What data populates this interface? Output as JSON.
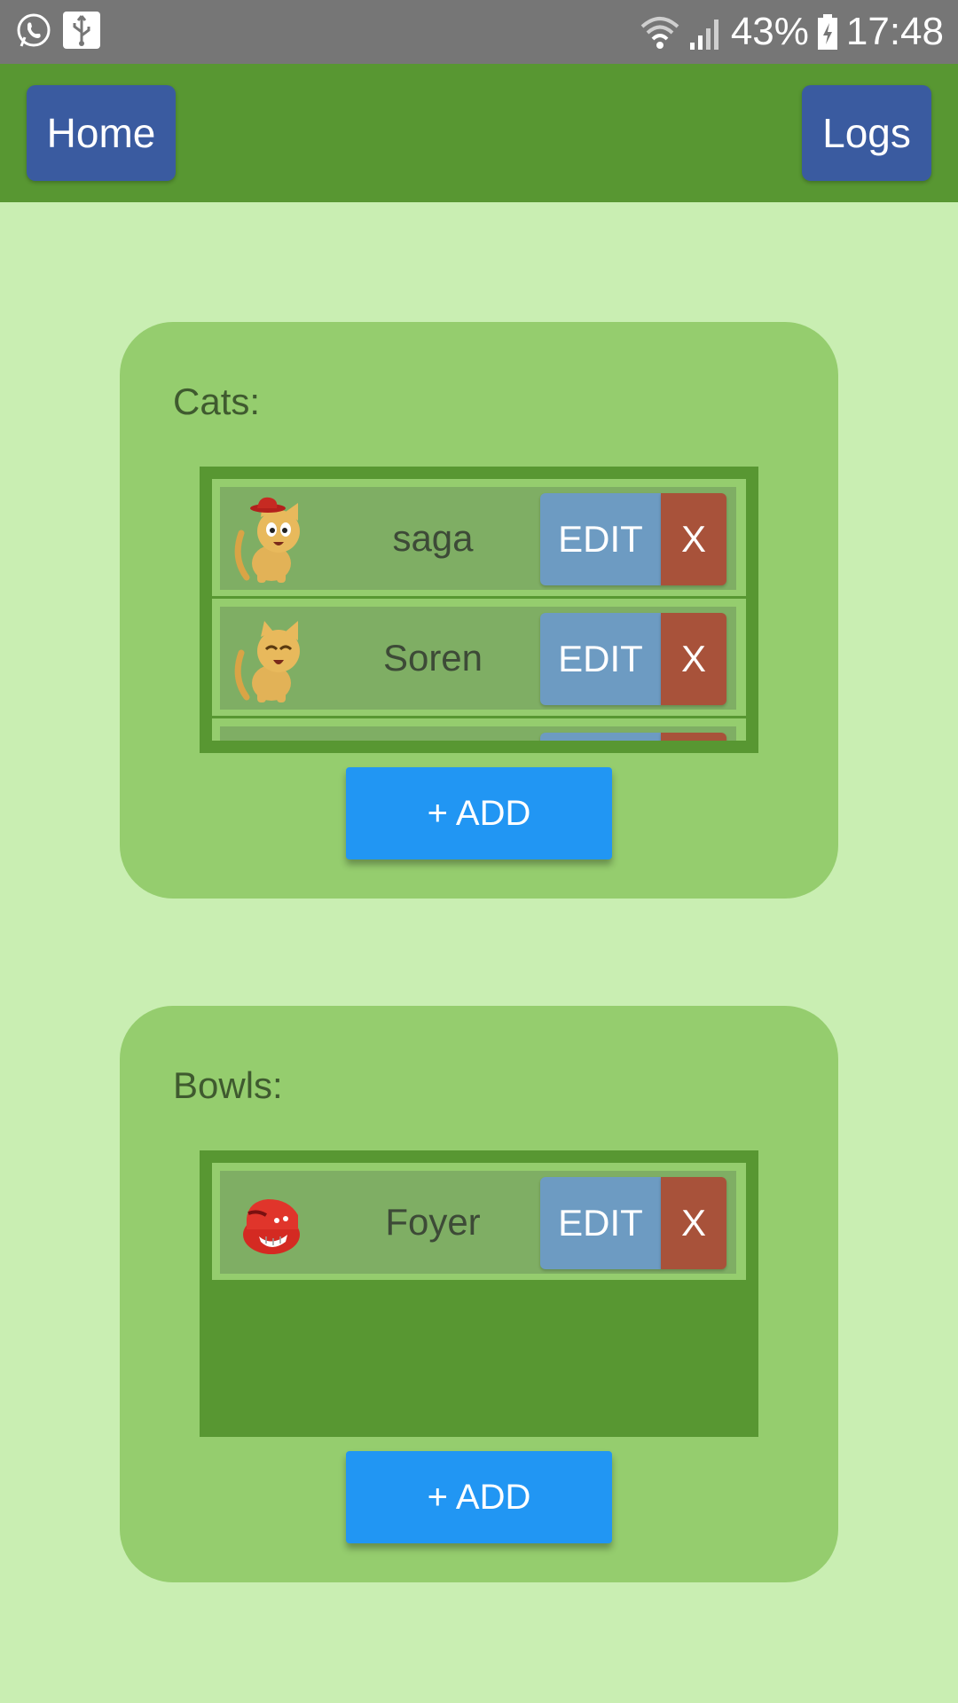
{
  "status_bar": {
    "battery": "43%",
    "time": "17:48",
    "icons": [
      "whatsapp-icon",
      "usb-icon",
      "wifi-icon",
      "signal-icon",
      "battery-charging-icon"
    ]
  },
  "header": {
    "home_label": "Home",
    "logs_label": "Logs"
  },
  "cats": {
    "title": "Cats:",
    "items": [
      {
        "name": "saga",
        "edit_label": "EDIT",
        "delete_label": "X",
        "avatar": "cat-with-hat-icon"
      },
      {
        "name": "Soren",
        "edit_label": "EDIT",
        "delete_label": "X",
        "avatar": "happy-cat-icon"
      }
    ],
    "add_label": "+ ADD"
  },
  "bowls": {
    "title": "Bowls:",
    "items": [
      {
        "name": "Foyer",
        "edit_label": "EDIT",
        "delete_label": "X",
        "avatar": "red-bowl-icon"
      }
    ],
    "add_label": "+ ADD"
  },
  "colors": {
    "page_bg": "#c9eeb2",
    "topbar": "#589732",
    "nav_button": "#3a5ba0",
    "card": "#95cd6e",
    "row": "#7fae64",
    "edit": "#6d9bc2",
    "delete": "#a8523a",
    "add": "#2196f3"
  }
}
